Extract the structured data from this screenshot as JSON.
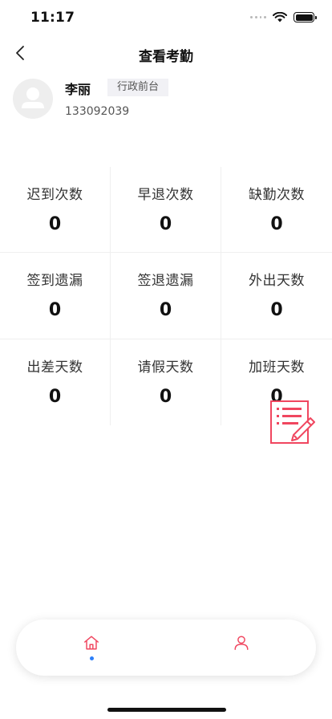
{
  "status_bar": {
    "time": "11:17"
  },
  "nav": {
    "title": "查看考勤"
  },
  "profile": {
    "name": "李丽",
    "department": "行政前台",
    "phone": "133092039"
  },
  "stats": [
    {
      "label": "迟到次数",
      "value": "0"
    },
    {
      "label": "早退次数",
      "value": "0"
    },
    {
      "label": "缺勤次数",
      "value": "0"
    },
    {
      "label": "签到遗漏",
      "value": "0"
    },
    {
      "label": "签退遗漏",
      "value": "0"
    },
    {
      "label": "外出天数",
      "value": "0"
    },
    {
      "label": "出差天数",
      "value": "0"
    },
    {
      "label": "请假天数",
      "value": "0"
    },
    {
      "label": "加班天数",
      "value": "0"
    }
  ],
  "tabs": [
    {
      "icon": "home-icon",
      "active": true
    },
    {
      "icon": "user-icon",
      "active": false
    }
  ],
  "colors": {
    "accent": "#f0465f",
    "active_dot": "#2d7ff9",
    "divider": "#efefef"
  }
}
